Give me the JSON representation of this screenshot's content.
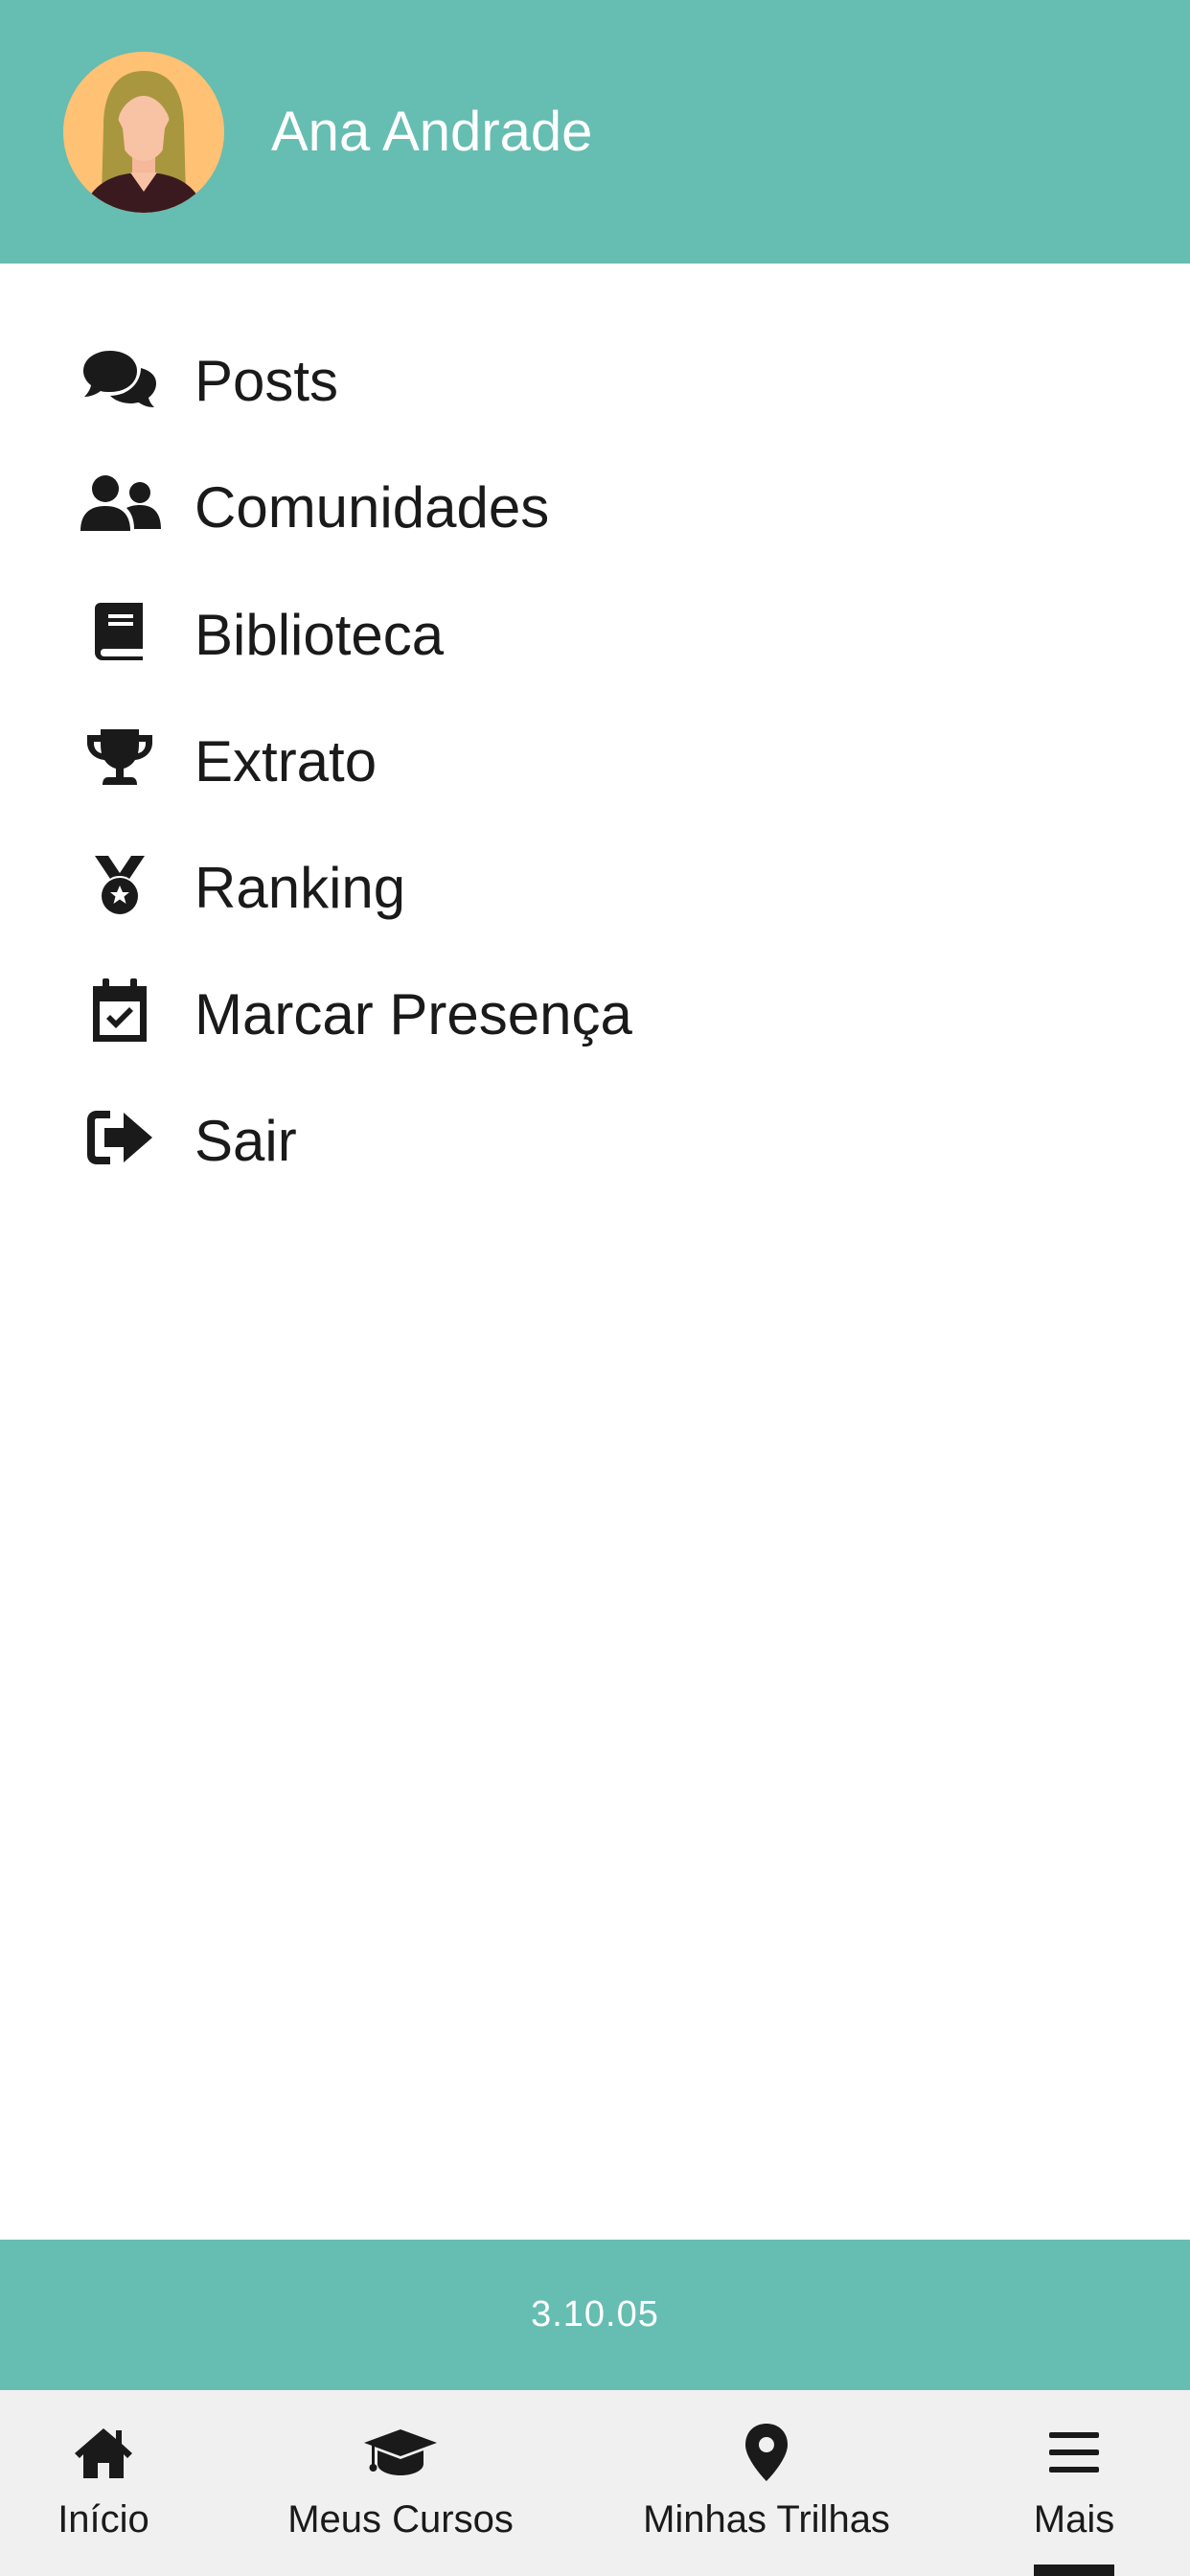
{
  "header": {
    "user_name": "Ana Andrade",
    "background_color": "#66bdb1"
  },
  "menu": {
    "items": [
      {
        "label": "Posts",
        "icon": "comments-icon"
      },
      {
        "label": "Comunidades",
        "icon": "users-icon"
      },
      {
        "label": "Biblioteca",
        "icon": "book-icon"
      },
      {
        "label": "Extrato",
        "icon": "trophy-icon"
      },
      {
        "label": "Ranking",
        "icon": "medal-icon"
      },
      {
        "label": "Marcar Presença",
        "icon": "calendar-check-icon"
      },
      {
        "label": "Sair",
        "icon": "sign-out-icon"
      }
    ]
  },
  "footer": {
    "version": "3.10.05"
  },
  "bottom_nav": {
    "items": [
      {
        "label": "Início",
        "icon": "home-icon",
        "active": false
      },
      {
        "label": "Meus Cursos",
        "icon": "graduation-cap-icon",
        "active": false
      },
      {
        "label": "Minhas Trilhas",
        "icon": "map-marker-icon",
        "active": false
      },
      {
        "label": "Mais",
        "icon": "menu-icon",
        "active": true
      }
    ]
  }
}
